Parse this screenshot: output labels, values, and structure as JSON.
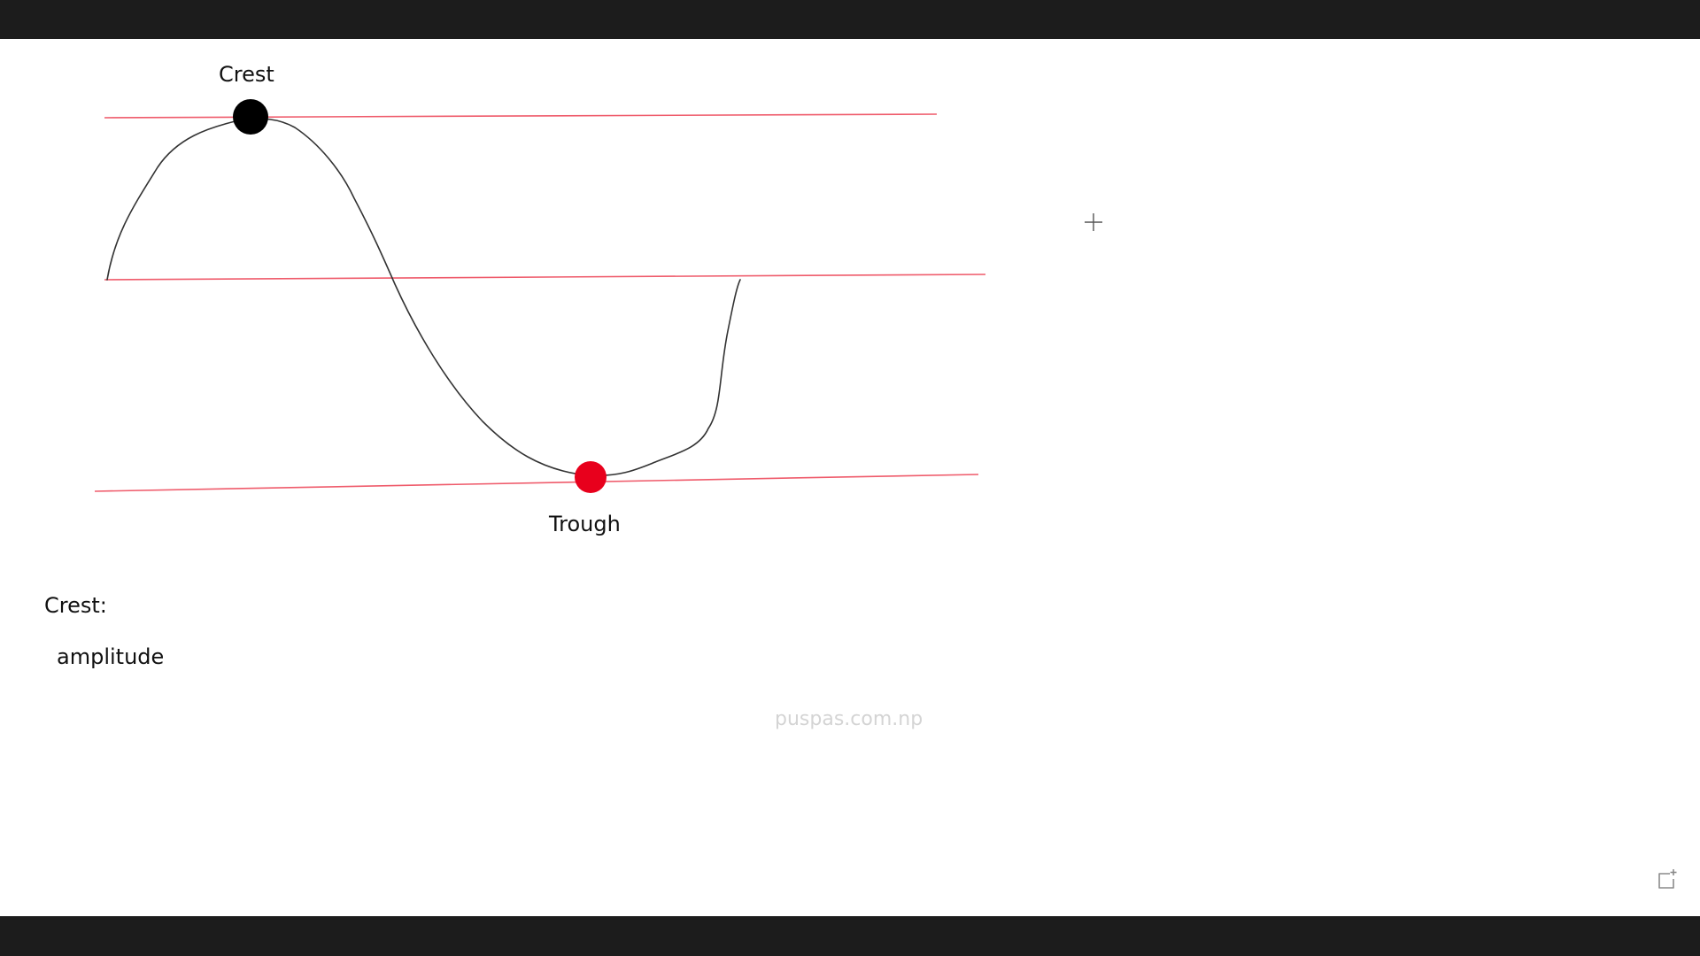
{
  "labels": {
    "crest_top": "Crest",
    "trough": "Trough",
    "crest_note": "Crest:",
    "amplitude": "amplitude"
  },
  "watermark": "puspas.com.np",
  "colors": {
    "reference_line": "#ef5b6b",
    "wave": "#333333",
    "crest_dot": "#000000",
    "trough_dot": "#e8001c",
    "background": "#ffffff",
    "frame": "#1c1c1c"
  },
  "icons": {
    "cursor": "crosshair-icon",
    "corner": "new-board-icon"
  }
}
